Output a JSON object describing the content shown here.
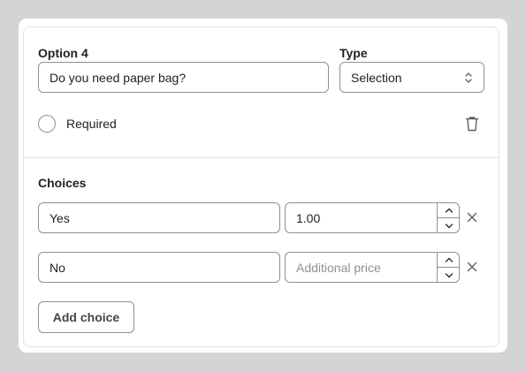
{
  "option": {
    "label": "Option 4",
    "question_value": "Do you need paper bag?"
  },
  "type": {
    "label": "Type",
    "selected": "Selection"
  },
  "required": {
    "label": "Required",
    "checked": false
  },
  "choices": {
    "label": "Choices",
    "items": [
      {
        "name": "Yes",
        "price": "1.00",
        "price_placeholder": "Additional price"
      },
      {
        "name": "No",
        "price": "",
        "price_placeholder": "Additional price"
      }
    ],
    "add_label": "Add choice"
  },
  "icons": {
    "select_arrows": "chevron-up-down-icon",
    "delete": "trash-icon",
    "increment": "chevron-up-icon",
    "decrement": "chevron-down-icon",
    "remove": "close-icon"
  },
  "colors": {
    "background": "#d4d4d4",
    "card": "#ffffff",
    "border": "#8c9196",
    "divider": "#e1e3e5",
    "text": "#202223",
    "placeholder": "#8c9196"
  }
}
